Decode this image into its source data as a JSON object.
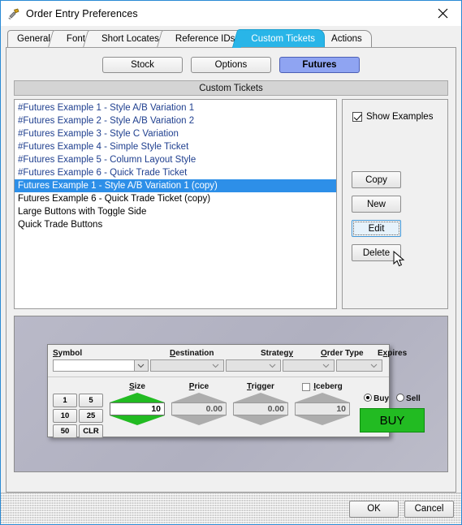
{
  "window": {
    "title": "Order Entry Preferences",
    "icon": "hammer-icon",
    "close_label": "✕"
  },
  "tabs": [
    {
      "label": "General",
      "active": false
    },
    {
      "label": "Font",
      "active": false
    },
    {
      "label": "Short Locates",
      "active": false
    },
    {
      "label": "Reference IDs",
      "active": false
    },
    {
      "label": "Custom Tickets",
      "active": true
    },
    {
      "label": "Actions",
      "active": false
    }
  ],
  "segments": [
    {
      "label": "Stock",
      "selected": false
    },
    {
      "label": "Options",
      "selected": false
    },
    {
      "label": "Futures",
      "selected": true
    }
  ],
  "group_header": "Custom Tickets",
  "list": {
    "items": [
      {
        "label": "#Futures Example 1 - Style A/B Variation 1",
        "example": true,
        "selected": false
      },
      {
        "label": "#Futures Example 2 - Style A/B Variation 2",
        "example": true,
        "selected": false
      },
      {
        "label": "#Futures Example 3 - Style C Variation",
        "example": true,
        "selected": false
      },
      {
        "label": "#Futures Example 4 - Simple Style Ticket",
        "example": true,
        "selected": false
      },
      {
        "label": "#Futures Example 5 - Column Layout Style",
        "example": true,
        "selected": false
      },
      {
        "label": "#Futures Example 6 - Quick Trade Ticket",
        "example": true,
        "selected": false
      },
      {
        "label": "Futures Example 1 - Style A/B Variation 1 (copy)",
        "example": false,
        "selected": true
      },
      {
        "label": "Futures Example 6 - Quick Trade Ticket (copy)",
        "example": false,
        "selected": false
      },
      {
        "label": "Large Buttons with Toggle Side",
        "example": false,
        "selected": false
      },
      {
        "label": "Quick Trade Buttons",
        "example": false,
        "selected": false
      }
    ]
  },
  "side_panel": {
    "show_examples": {
      "label": "Show Examples",
      "checked": true
    },
    "buttons": [
      {
        "label": "Copy",
        "focused": false
      },
      {
        "label": "New",
        "focused": false
      },
      {
        "label": "Edit",
        "focused": true
      },
      {
        "label": "Delete",
        "focused": false
      }
    ]
  },
  "preview": {
    "fields": [
      {
        "label_before": "S",
        "label_mnemonic": "",
        "label": "Symbol",
        "mnemonic_index": 0,
        "value": "",
        "style": "white"
      },
      {
        "label": "Destination",
        "mnemonic_index": 0,
        "value": "",
        "style": "gray"
      },
      {
        "label": "Strategy",
        "mnemonic_index": 7,
        "value": "",
        "style": "gray"
      },
      {
        "label": "Order Type",
        "mnemonic_index": 0,
        "value": "",
        "style": "gray"
      },
      {
        "label": "Expires",
        "mnemonic_index": 1,
        "value": "",
        "style": "gray"
      }
    ],
    "qty_buttons": [
      "1",
      "5",
      "10",
      "25",
      "50",
      "CLR"
    ],
    "spinners": [
      {
        "label": "Size",
        "mnemonic_index": 0,
        "value": "10",
        "active": true,
        "arrow_color": "#22bb22"
      },
      {
        "label": "Price",
        "mnemonic_index": 0,
        "value": "0.00",
        "active": false,
        "arrow_color": "#a8a8a8"
      },
      {
        "label": "Trigger",
        "mnemonic_index": 0,
        "value": "0.00",
        "active": false,
        "arrow_color": "#a8a8a8"
      }
    ],
    "iceberg": {
      "label": "Iceberg",
      "mnemonic_index": 0,
      "checked": false,
      "value": "10"
    },
    "side": {
      "buy_label": "Buy",
      "sell_label": "Sell",
      "selected": "Buy",
      "action_label": "BUY"
    }
  },
  "dialog_buttons": [
    {
      "label": "OK"
    },
    {
      "label": "Cancel"
    }
  ],
  "colors": {
    "tab_active": "#29b5e8",
    "segment_selected": "#8fa4f2",
    "list_selection": "#2d8fe8",
    "example_text": "#1f3f8f",
    "buy_green": "#22bb22",
    "window_border": "#2a8ad4",
    "preview_bg": "#b4b4c4"
  }
}
